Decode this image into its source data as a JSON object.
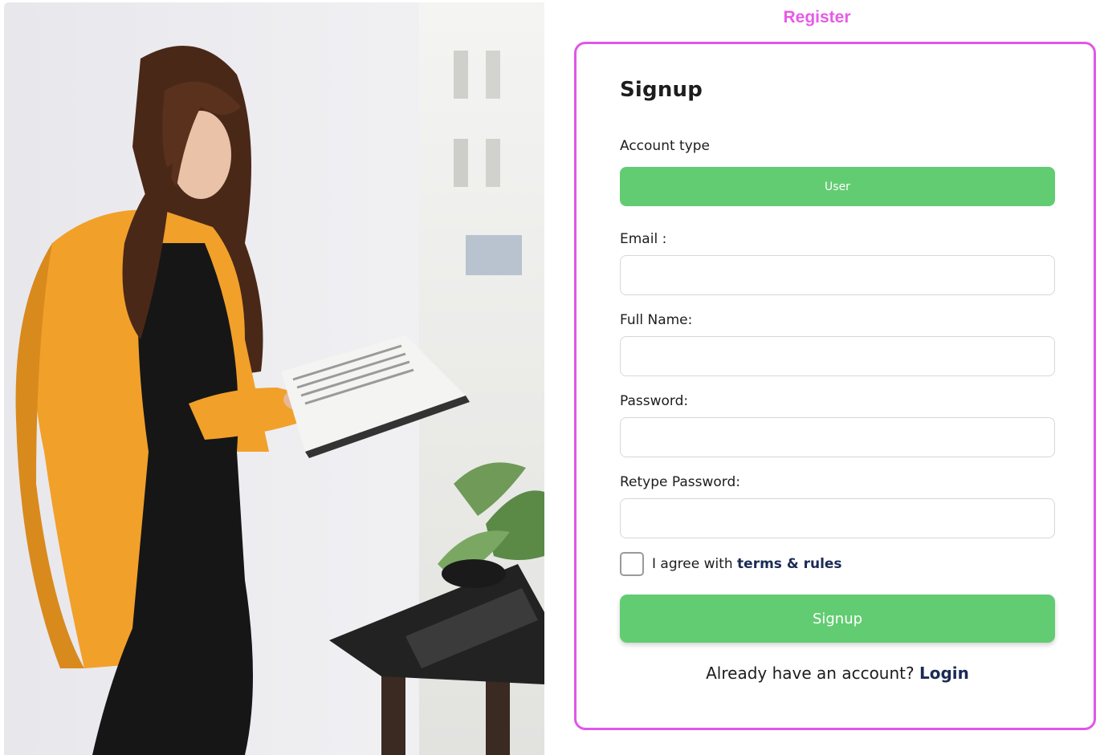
{
  "header": {
    "title": "Register"
  },
  "form": {
    "title": "Signup",
    "account_type_label": "Account type",
    "account_type_value": "User",
    "email_label": "Email :",
    "full_name_label": "Full Name:",
    "password_label": "Password:",
    "retype_password_label": "Retype Password:",
    "agree_prefix": "I agree with ",
    "terms_link": "terms & rules",
    "signup_button": "Signup",
    "login_prompt": "Already have an account? ",
    "login_link": "Login"
  },
  "colors": {
    "accent_pink": "#e256e8",
    "button_green": "#62cc72",
    "link_navy": "#1b2b55"
  }
}
